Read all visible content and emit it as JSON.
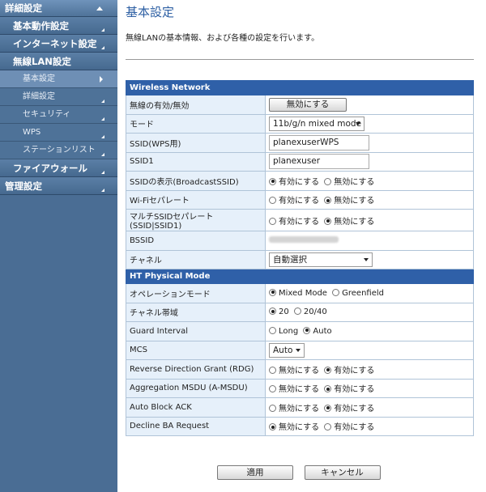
{
  "sidebar": {
    "items": [
      {
        "label": "詳細設定",
        "kind": "top"
      },
      {
        "label": "基本動作設定",
        "kind": "item"
      },
      {
        "label": "インターネット設定",
        "kind": "item"
      },
      {
        "label": "無線LAN設定",
        "kind": "item"
      },
      {
        "label": "基本設定",
        "kind": "sub",
        "active": true
      },
      {
        "label": "詳細設定",
        "kind": "sub"
      },
      {
        "label": "セキュリティ",
        "kind": "sub"
      },
      {
        "label": "WPS",
        "kind": "sub"
      },
      {
        "label": "ステーションリスト",
        "kind": "sub"
      },
      {
        "label": "ファイアウォール",
        "kind": "item"
      },
      {
        "label": "管理設定",
        "kind": "top2"
      }
    ]
  },
  "page": {
    "title": "基本設定",
    "description": "無線LANの基本情報、および各種の設定を行います。"
  },
  "wireless": {
    "header": "Wireless Network",
    "enable_label": "無線の有効/無効",
    "enable_button": "無効にする",
    "mode_label": "モード",
    "mode_value": "11b/g/n mixed mode",
    "ssid_wps_label": "SSID(WPS用)",
    "ssid_wps_value": "planexuserWPS",
    "ssid1_label": "SSID1",
    "ssid1_value": "planexuser",
    "broadcast_label": "SSIDの表示(BroadcastSSID)",
    "broadcast_opt1": "有効にする",
    "broadcast_opt2": "無効にする",
    "wifi_sep_label": "Wi-Fiセパレート",
    "wifi_sep_opt1": "有効にする",
    "wifi_sep_opt2": "無効にする",
    "multi_sep_label": "マルチSSIDセパレート(SSID|SSID1)",
    "multi_sep_opt1": "有効にする",
    "multi_sep_opt2": "無効にする",
    "bssid_label": "BSSID",
    "channel_label": "チャネル",
    "channel_value": "自動選択"
  },
  "ht": {
    "header": "HT Physical Mode",
    "op_label": "オペレーションモード",
    "op_opt1": "Mixed Mode",
    "op_opt2": "Greenfield",
    "bw_label": "チャネル帯域",
    "bw_opt1": "20",
    "bw_opt2": "20/40",
    "gi_label": "Guard Interval",
    "gi_opt1": "Long",
    "gi_opt2": "Auto",
    "mcs_label": "MCS",
    "mcs_value": "Auto",
    "rdg_label": "Reverse Direction Grant (RDG)",
    "rdg_opt1": "無効にする",
    "rdg_opt2": "有効にする",
    "amsdu_label": "Aggregation MSDU (A-MSDU)",
    "amsdu_opt1": "無効にする",
    "amsdu_opt2": "有効にする",
    "aback_label": "Auto Block ACK",
    "aback_opt1": "無効にする",
    "aback_opt2": "有効にする",
    "dba_label": "Decline BA Request",
    "dba_opt1": "無効にする",
    "dba_opt2": "有効にする"
  },
  "footer": {
    "apply": "適用",
    "cancel": "キャンセル"
  }
}
